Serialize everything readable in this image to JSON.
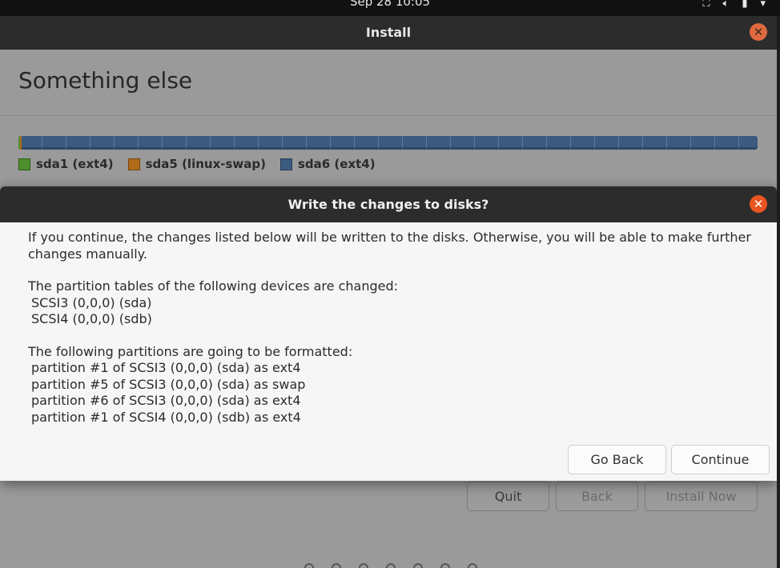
{
  "system": {
    "clock": "Sep 28  10:05",
    "tray_icons": [
      "network-icon",
      "volume-icon",
      "battery-icon",
      "menu-chevron-icon"
    ]
  },
  "window": {
    "title": "Install",
    "page_title": "Something else"
  },
  "partitions": {
    "legend": [
      {
        "label": "sda1 (ext4)",
        "color": "#4c8f2c"
      },
      {
        "label": "sda5 (linux-swap)",
        "color": "#b06a1a"
      },
      {
        "label": "sda6 (ext4)",
        "color": "#3b5a80"
      }
    ]
  },
  "dialog": {
    "title": "Write the changes to disks?",
    "intro": "If you continue, the changes listed below will be written to the disks. Otherwise, you will be able to make further changes manually.",
    "tables_heading": "The partition tables of the following devices are changed:",
    "devices": [
      "SCSI3 (0,0,0) (sda)",
      "SCSI4 (0,0,0) (sdb)"
    ],
    "format_heading": "The following partitions are going to be formatted:",
    "formatted": [
      "partition #1 of SCSI3 (0,0,0) (sda) as ext4",
      "partition #5 of SCSI3 (0,0,0) (sda) as swap",
      "partition #6 of SCSI3 (0,0,0) (sda) as ext4",
      "partition #1 of SCSI4 (0,0,0) (sdb) as ext4"
    ],
    "go_back_label": "Go Back",
    "continue_label": "Continue"
  },
  "footer": {
    "quit_label": "Quit",
    "back_label": "Back",
    "install_label": "Install Now"
  },
  "colors": {
    "accent": "#e95420",
    "titlebar": "#2c2c2c"
  }
}
